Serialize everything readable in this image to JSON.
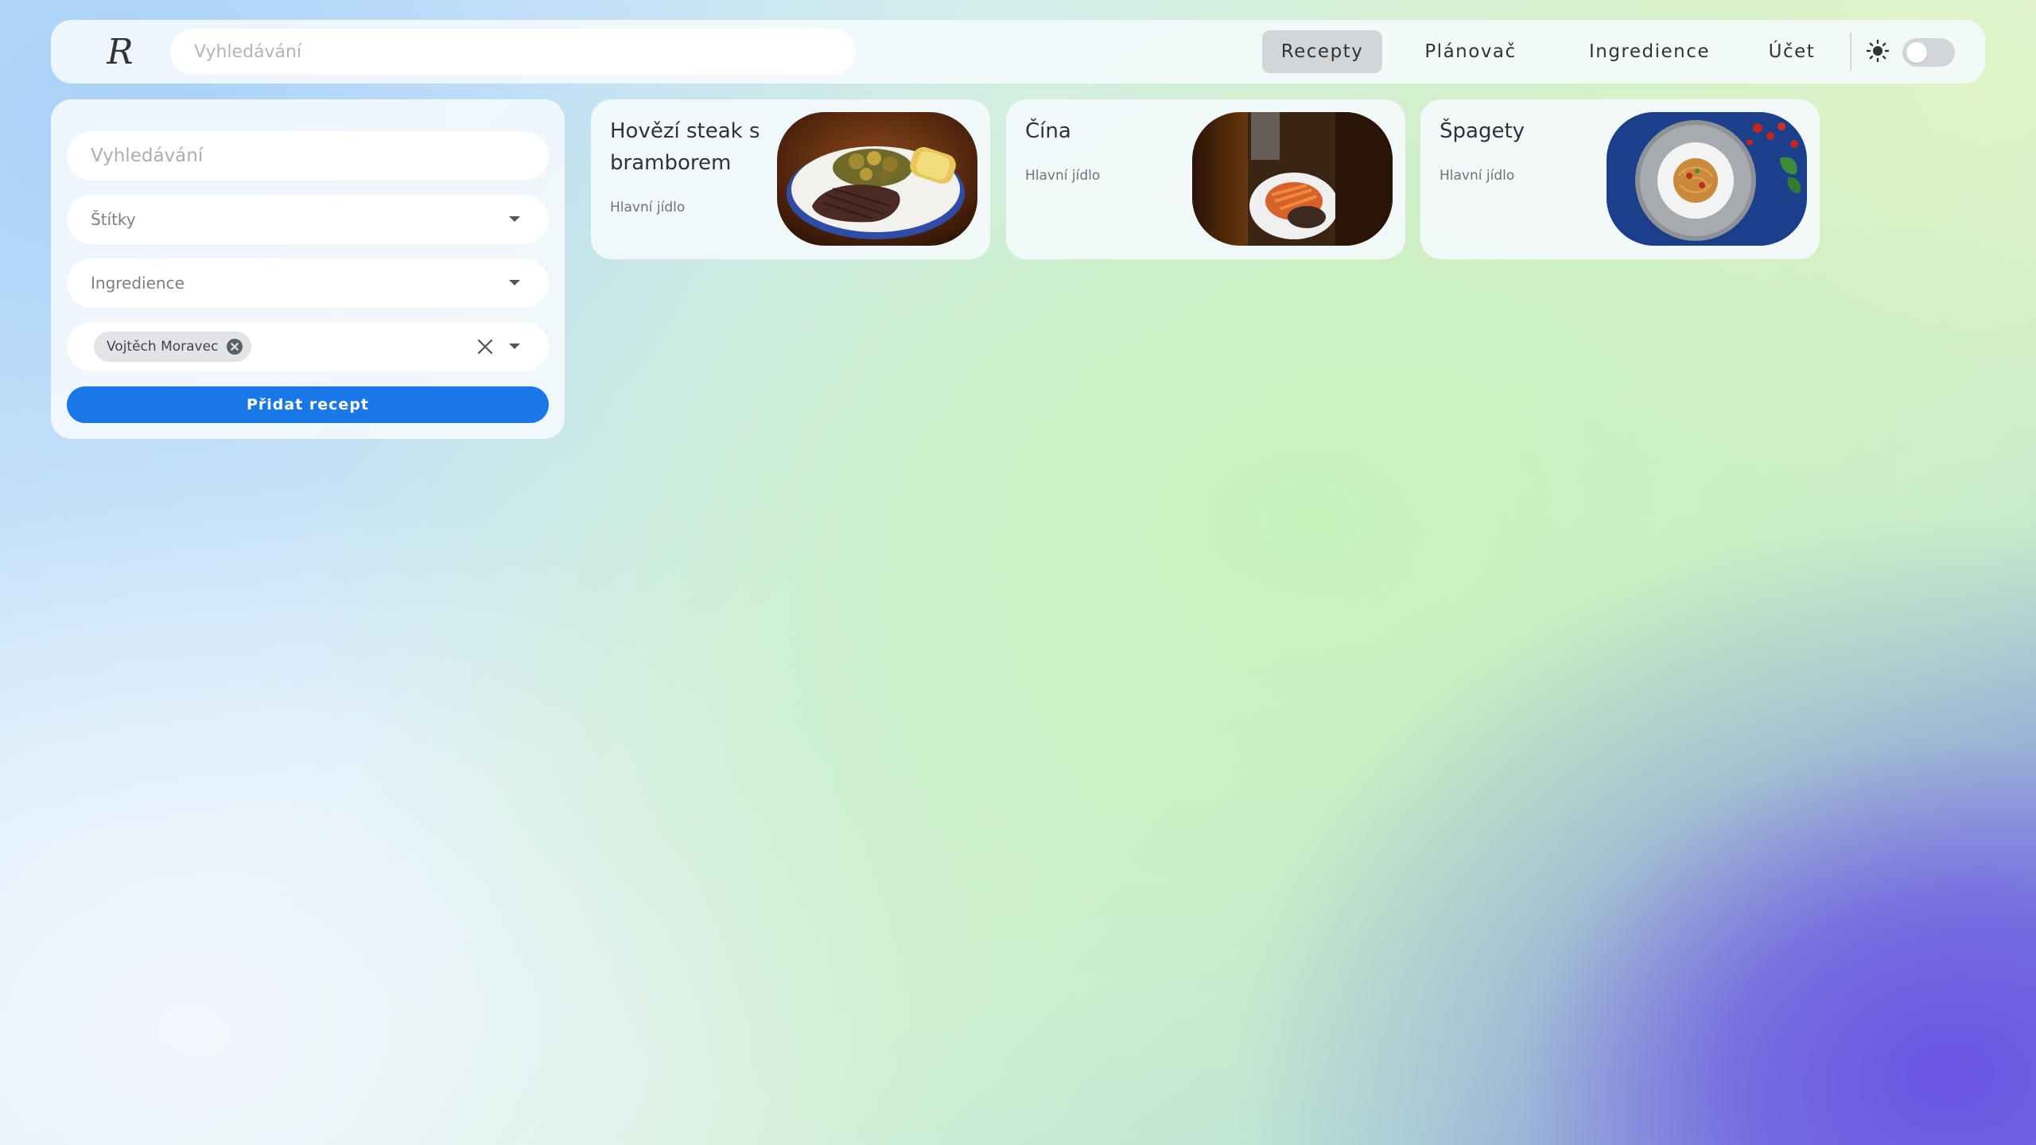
{
  "topbar": {
    "logo_letter": "R",
    "search_placeholder": "Vyhledávání",
    "nav": [
      "Recepty",
      "Plánovač",
      "Ingredience",
      "Účet"
    ],
    "active_nav": "Recepty",
    "theme_toggle_on": false
  },
  "filters": {
    "search_placeholder": "Vyhledávání",
    "tags_label": "Štítky",
    "ingredients_label": "Ingredience",
    "author_chip": "Vojtěch Moravec",
    "add_button": "Přidat recept"
  },
  "recipes": [
    {
      "title": "Hovězí steak s bramborem",
      "category": "Hlavní jídlo",
      "image": "steak-with-potatoes-photo"
    },
    {
      "title": "Čína",
      "category": "Hlavní jídlo",
      "image": "chinese-dish-photo"
    },
    {
      "title": "Špagety",
      "category": "Hlavní jídlo",
      "image": "spaghetti-plate-photo"
    }
  ],
  "colors": {
    "primary": "#1a77e8",
    "active_tab": "#d3d6d9",
    "panel": "#f5fafd"
  }
}
